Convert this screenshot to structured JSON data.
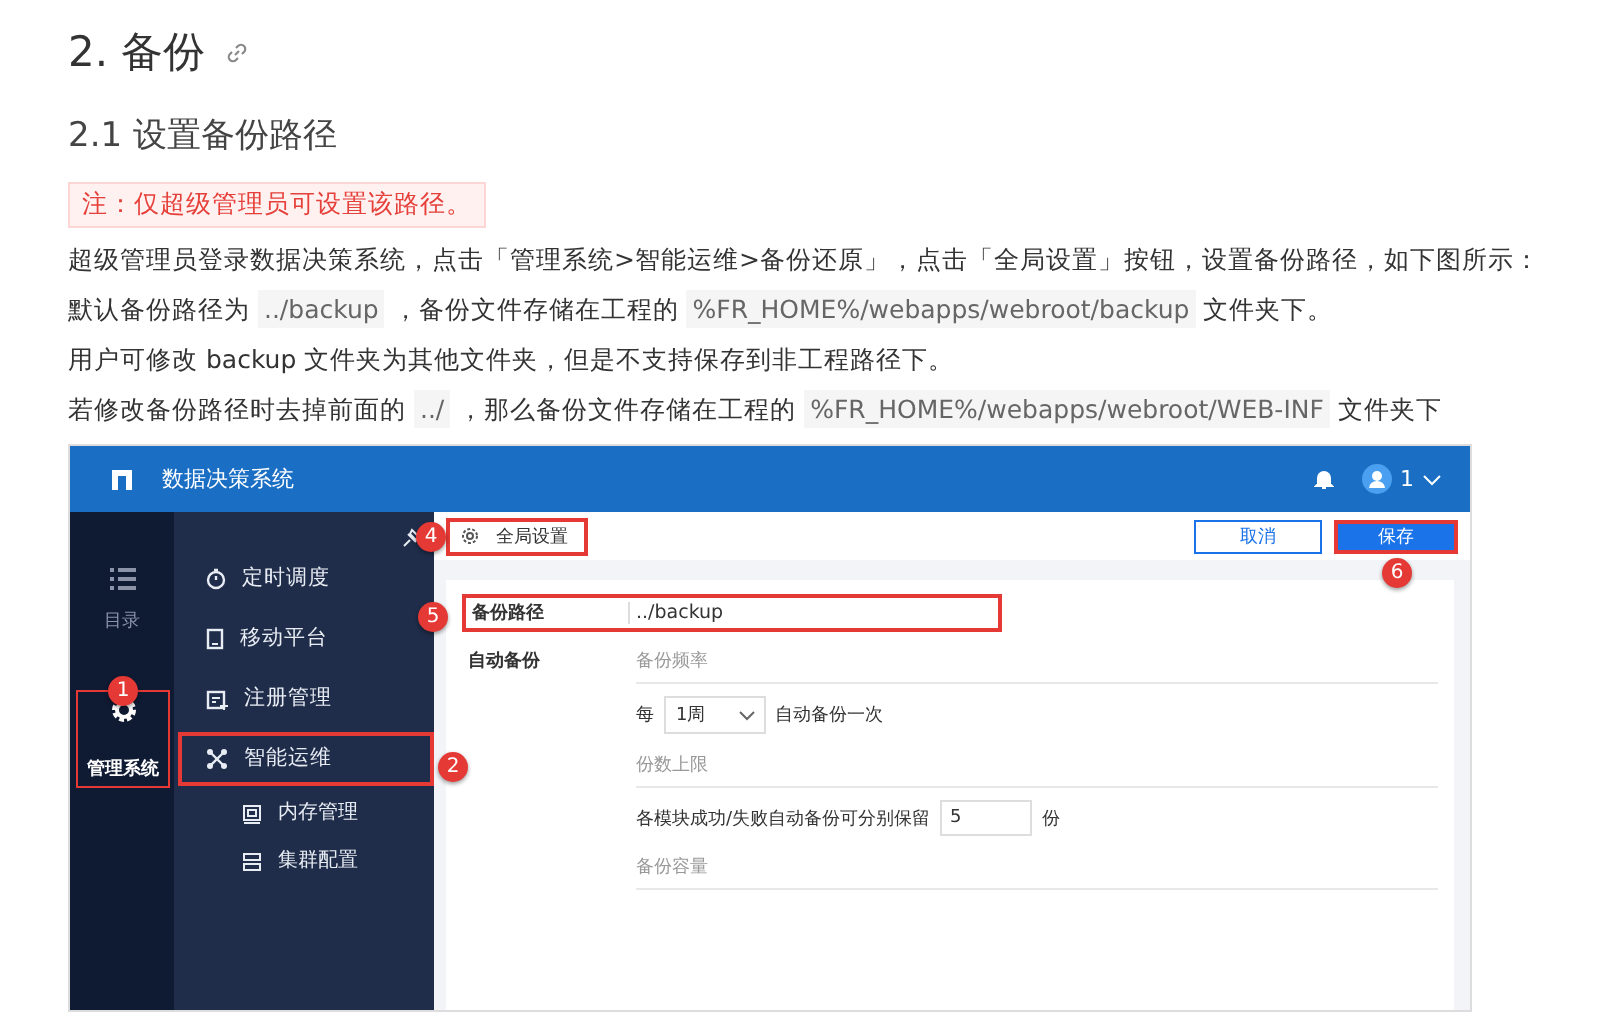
{
  "heading": {
    "text": "2. 备份"
  },
  "section": {
    "title": "2.1 设置备份路径"
  },
  "note": "注：仅超级管理员可设置该路径。",
  "paragraphs": [
    [
      {
        "kind": "text",
        "text": "超级管理员登录数据决策系统，点击「管理系统>智能运维>备份还原」，点击「全局设置」按钮，设置备份路径，如下图所示："
      }
    ],
    [
      {
        "kind": "text",
        "text": "默认备份路径为 "
      },
      {
        "kind": "code",
        "text": "../backup"
      },
      {
        "kind": "text",
        "text": " ，备份文件存储在工程的 "
      },
      {
        "kind": "code",
        "text": "%FR_HOME%/webapps/webroot/backup"
      },
      {
        "kind": "text",
        "text": " 文件夹下。"
      }
    ],
    [
      {
        "kind": "text",
        "text": "用户可修改 backup 文件夹为其他文件夹，但是不支持保存到非工程路径下。"
      }
    ],
    [
      {
        "kind": "text",
        "text": "若修改备份路径时去掉前面的 "
      },
      {
        "kind": "code",
        "text": "../"
      },
      {
        "kind": "text",
        "text": " ，那么备份文件存储在工程的 "
      },
      {
        "kind": "code",
        "text": "%FR_HOME%/webapps/webroot/WEB-INF"
      },
      {
        "kind": "text",
        "text": " 文件夹下"
      }
    ]
  ],
  "app": {
    "title": "数据决策系统",
    "user": "1",
    "rail": [
      {
        "label": "目录",
        "selected": false,
        "outlined": false
      },
      {
        "label": "管理系统",
        "selected": true,
        "outlined": true
      }
    ],
    "menu": [
      {
        "label": "定时调度",
        "kind": "timer",
        "outlined": false
      },
      {
        "label": "移动平台",
        "kind": "mobile",
        "outlined": false
      },
      {
        "label": "注册管理",
        "kind": "register",
        "outlined": false
      },
      {
        "label": "智能运维",
        "kind": "ops",
        "outlined": true,
        "children": [
          {
            "label": "内存管理",
            "kind": "memory"
          },
          {
            "label": "集群配置",
            "kind": "cluster"
          }
        ]
      }
    ],
    "toolbar": {
      "title": "全局设置",
      "cancel": "取消",
      "save": "保存"
    },
    "form": {
      "path_label": "备份路径",
      "path_value": "../backup",
      "auto_label": "自动备份",
      "sections": [
        {
          "title": "备份频率",
          "kind": "select",
          "prefix": "每",
          "value": "1周",
          "suffix": "自动备份一次"
        },
        {
          "title": "份数上限",
          "kind": "number",
          "prefix": "各模块成功/失败自动备份可分别保留",
          "value": "5",
          "suffix": "份"
        },
        {
          "title": "备份容量"
        }
      ]
    },
    "callouts": [
      "1",
      "2",
      "4",
      "5",
      "6"
    ]
  }
}
